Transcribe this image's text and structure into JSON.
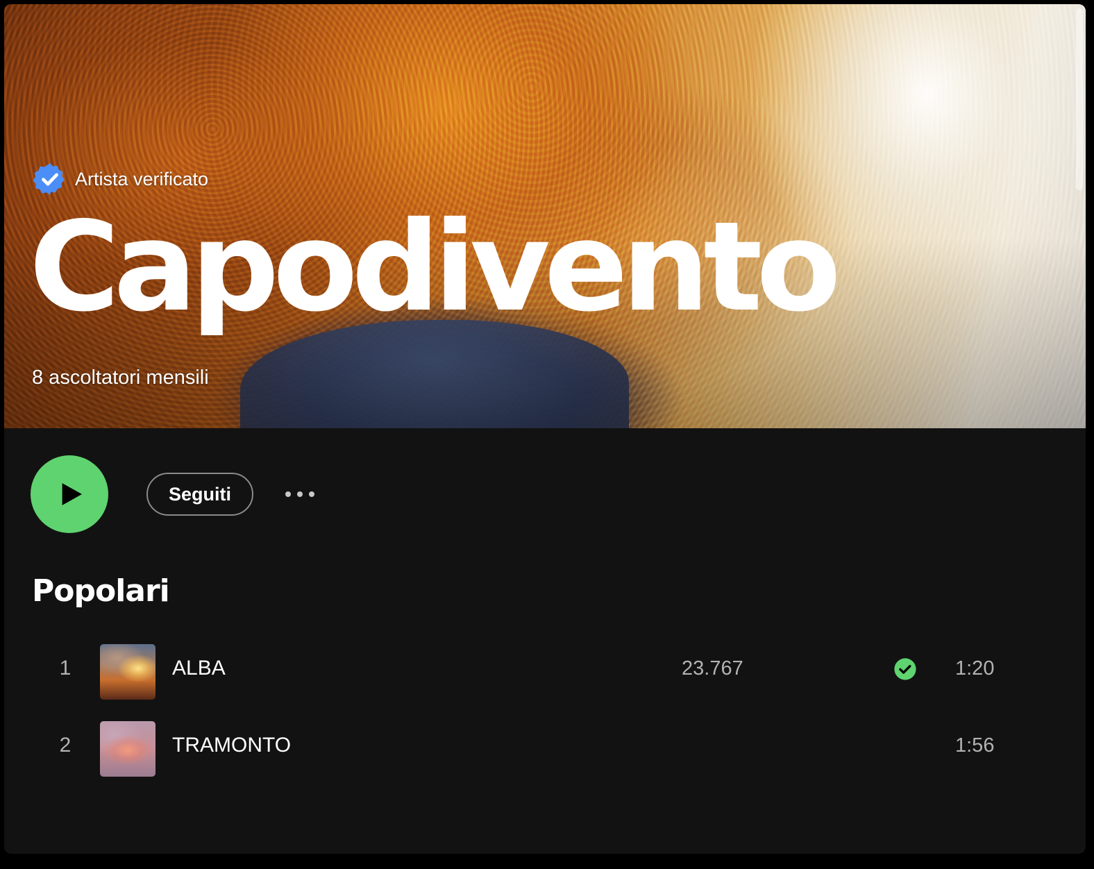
{
  "artist": {
    "verified_label": "Artista verificato",
    "name": "Capodivento",
    "monthly_listeners": "8 ascoltatori mensili"
  },
  "actions": {
    "follow_label": "Seguiti"
  },
  "popular": {
    "title": "Popolari",
    "tracks": [
      {
        "number": "1",
        "title": "ALBA",
        "plays": "23.767",
        "saved": true,
        "duration": "1:20"
      },
      {
        "number": "2",
        "title": "TRAMONTO",
        "plays": "",
        "saved": false,
        "duration": "1:56"
      }
    ]
  },
  "colors": {
    "accent_green": "#5fd36f",
    "verified_blue": "#4c8ef7",
    "header_tint": "#3d1b0f",
    "background": "#121212"
  },
  "icons": {
    "verified": "verified-badge-icon",
    "play": "play-icon",
    "more": "more-options-icon",
    "saved": "check-circle-icon"
  }
}
